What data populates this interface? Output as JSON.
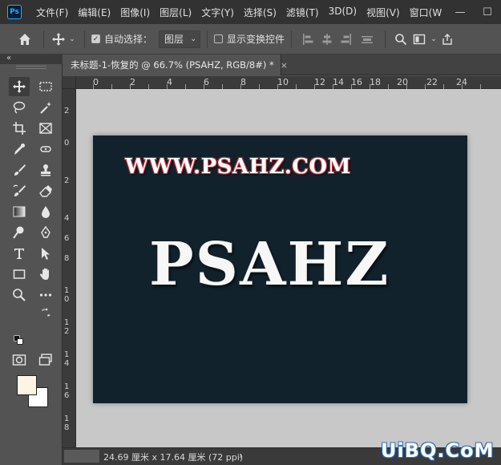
{
  "app": {
    "logo": "Ps"
  },
  "menu": [
    "文件(F)",
    "编辑(E)",
    "图像(I)",
    "图层(L)",
    "文字(Y)",
    "选择(S)",
    "滤镜(T)",
    "3D(D)",
    "视图(V)",
    "窗口(W"
  ],
  "window_controls": {
    "minimize": "—",
    "maximize": "☐"
  },
  "options": {
    "auto_select_label": "自动选择：",
    "layer_select_value": "图层",
    "show_transform_label": "显示变换控件"
  },
  "collapse_label": "«",
  "document_tab": {
    "title": "未标题-1-恢复的 @ 66.7% (PSAHZ, RGB/8#) *",
    "close": "×"
  },
  "ruler_h_labels": [
    "0",
    "2",
    "4",
    "6",
    "8",
    "10",
    "12",
    "14",
    "16",
    "18",
    "20",
    "22",
    "24"
  ],
  "ruler_v_labels": [
    "2",
    "0",
    "2",
    "4",
    "6",
    "8",
    "10",
    "12",
    "14",
    "16",
    "18"
  ],
  "canvas": {
    "url_text": "WWW.PSAHZ.COM",
    "main_text": "PSAHZ",
    "background": "#12222c"
  },
  "colors": {
    "foreground": "#fdf5e4",
    "background": "#ffffff"
  },
  "status": {
    "doc_size": "24.69 厘米 x 17.64 厘米 (72 ppi)",
    "arrow": "›"
  },
  "watermark": "UiBQ.CoM"
}
